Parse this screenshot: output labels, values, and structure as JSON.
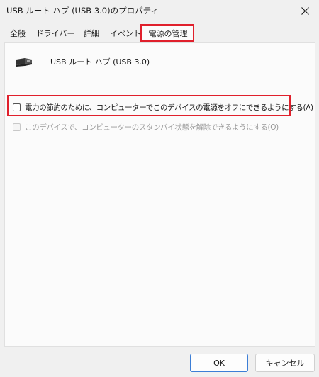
{
  "window": {
    "title": "USB ルート ハブ (USB 3.0)のプロパティ",
    "close_icon": "close-icon"
  },
  "tabs": [
    {
      "label": "全般"
    },
    {
      "label": "ドライバー"
    },
    {
      "label": "詳細"
    },
    {
      "label": "イベント"
    },
    {
      "label": "電源の管理",
      "active": true
    }
  ],
  "device": {
    "icon": "usb-plug-icon",
    "name": "USB ルート ハブ (USB 3.0)"
  },
  "options": {
    "allow_power_off": {
      "label": "電力の節約のために、コンピューターでこのデバイスの電源をオフにできるようにする(A)",
      "checked": false,
      "enabled": true
    },
    "allow_wake": {
      "label": "このデバイスで、コンピューターのスタンバイ状態を解除できるようにする(O)",
      "checked": false,
      "enabled": false
    }
  },
  "buttons": {
    "ok": "OK",
    "cancel": "キャンセル"
  },
  "colors": {
    "highlight": "#e0202c",
    "panel": "#fbfbfb",
    "window": "#f0f0f0",
    "ok_border": "#3c7ed6"
  }
}
